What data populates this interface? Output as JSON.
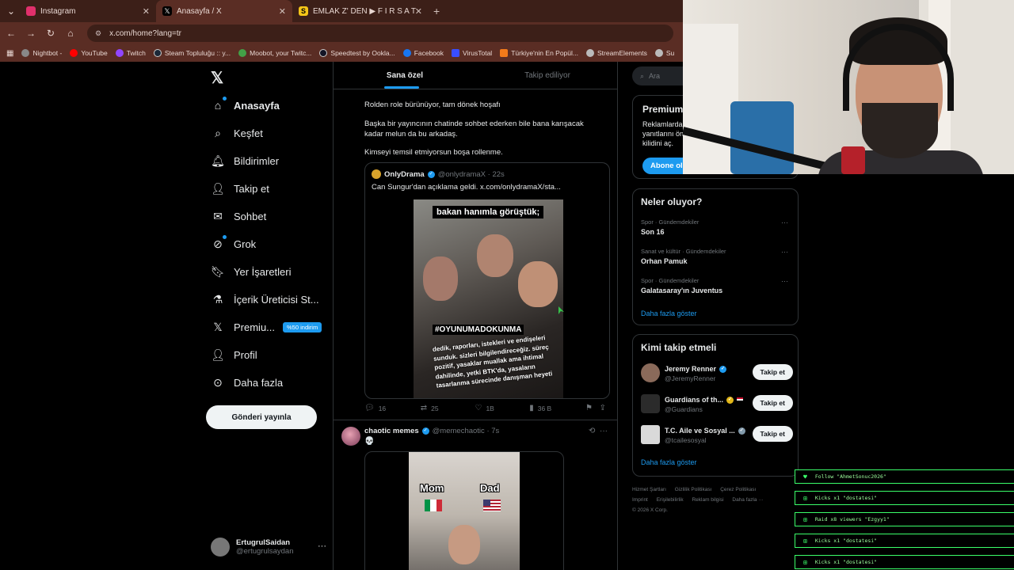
{
  "browser": {
    "tabs": [
      {
        "label": "Instagram",
        "color": "#e1306c"
      },
      {
        "label": "Anasayfa / X",
        "color": "#000000"
      },
      {
        "label": "EMLAK Z' DEN ▶ F I R S A T I",
        "color": "#f5c518"
      }
    ],
    "url": "x.com/home?lang=tr",
    "bookmarks": [
      {
        "label": "Nightbot -",
        "color": "#888888"
      },
      {
        "label": "YouTube",
        "color": "#ff0000"
      },
      {
        "label": "Twitch",
        "color": "#9146ff"
      },
      {
        "label": "Steam Topluluğu :: y...",
        "color": "#1b2838"
      },
      {
        "label": "Moobot, your Twitc...",
        "color": "#43a047"
      },
      {
        "label": "Speedtest by Ookla...",
        "color": "#141526"
      },
      {
        "label": "Facebook",
        "color": "#1877f2"
      },
      {
        "label": "VirusTotal",
        "color": "#394eff"
      },
      {
        "label": "Türkiye'nin En Popül...",
        "color": "#f27a1a"
      },
      {
        "label": "StreamElements",
        "color": "#bbbbbb"
      },
      {
        "label": "Su",
        "color": "#bbbbbb"
      }
    ]
  },
  "nav": {
    "items": [
      {
        "label": "Anasayfa",
        "icon": "home-icon"
      },
      {
        "label": "Keşfet",
        "icon": "search-icon"
      },
      {
        "label": "Bildirimler",
        "icon": "bell-icon"
      },
      {
        "label": "Takip et",
        "icon": "person-plus-icon"
      },
      {
        "label": "Sohbet",
        "icon": "mail-icon"
      },
      {
        "label": "Grok",
        "icon": "grok-icon"
      },
      {
        "label": "Yer İşaretleri",
        "icon": "bookmark-icon"
      },
      {
        "label": "İçerik Üreticisi St...",
        "icon": "flask-icon"
      },
      {
        "label": "Premiu...",
        "icon": "x-icon"
      },
      {
        "label": "Profil",
        "icon": "person-icon"
      },
      {
        "label": "Daha fazla",
        "icon": "more-circle-icon"
      }
    ],
    "premium_badge": "%50 indirim",
    "post_button": "Gönderi yayınla",
    "user": {
      "name": "ErtugrulSaidan",
      "handle": "@ertugrulsaydan"
    }
  },
  "feed": {
    "tabs": [
      "Sana özel",
      "Takip ediliyor"
    ],
    "tweet1": {
      "lines": [
        "Rolden role bürünüyor, tam dönek hoşafı",
        "Başka bir yayıncının chatinde sohbet ederken bile bana karışacak kadar melun da bu arkadaş.",
        "Kimseyi temsil etmiyorsun boşa rollenme."
      ],
      "quote": {
        "name": "OnlyDrama",
        "handle": "@onlydramaX",
        "time": "· 22s",
        "text": "Can Sungur'dan açıklama geldi.  x.com/onlydramaX/sta...",
        "image_caption": "bakan hanımla görüştük;",
        "image_tag": "#OYUNUMADOKUNMA",
        "image_paragraph": "dedik, raporları, istekleri ve endişeleri sunduk. sizleri bilgilendireceğiz. süreç pozitif, yasaklar muallak ama ihtimal dahilinde, yetki BTK'da, yasaların tasarlanma sürecinde danışman heyeti"
      },
      "actions": {
        "replies": "16",
        "retweets": "25",
        "likes": "1B",
        "views": "36 B"
      }
    },
    "tweet2": {
      "name": "chaotic memes",
      "handle": "@memechaotic",
      "time": "· 7s",
      "text": "💀",
      "meme_left": "Mom",
      "meme_right": "Dad"
    }
  },
  "right": {
    "search_placeholder": "Ara",
    "premium": {
      "title": "Premium",
      "text": "Reklamlarda\nyanıtlarını ön\nkilidini aç.",
      "button": "Abone ol"
    },
    "trends_title": "Neler oluyor?",
    "trends": [
      {
        "meta": "Spor · Gündemdekiler",
        "name": "Son 16"
      },
      {
        "meta": "Sanat ve kültür · Gündemdekiler",
        "name": "Orhan Pamuk"
      },
      {
        "meta": "Spor · Gündemdekiler",
        "name": "Galatasaray'ın Juventus"
      }
    ],
    "show_more": "Daha fazla göster",
    "follow_title": "Kimi takip etmeli",
    "follow": [
      {
        "name": "Jeremy Renner",
        "handle": "@JeremyRenner",
        "verified": "blue",
        "avatar": "#8a6a5a"
      },
      {
        "name": "Guardians of th...",
        "handle": "@Guardians",
        "verified": "gold",
        "avatar": "#2b2b2b"
      },
      {
        "name": "T.C. Aile ve Sosyal ...",
        "handle": "@tcailesosyal",
        "verified": "grey",
        "avatar": "#d9d9d9"
      }
    ],
    "follow_button": "Takip et",
    "footer_line1": [
      "Hizmet Şartları",
      "Gizlilik Politikası",
      "Çerez Politikası"
    ],
    "footer_line2": [
      "Imprint",
      "Erişilebilirlik",
      "Reklam bilgisi",
      "Daha fazla ···"
    ],
    "copyright": "© 2026 X Corp."
  },
  "stream_overlay": [
    {
      "icon": "heart-icon",
      "text": "Follow \"AhmetSonuc2026\""
    },
    {
      "icon": "kick-icon",
      "text": "Kicks x1 \"dostatesi\""
    },
    {
      "icon": "kick-icon",
      "text": "Raid x8 viewers \"Ezgyy1\""
    },
    {
      "icon": "kick-icon",
      "text": "Kicks x1 \"dostatesi\""
    },
    {
      "icon": "kick-icon",
      "text": "Kicks x1 \"dostatesi\""
    }
  ]
}
